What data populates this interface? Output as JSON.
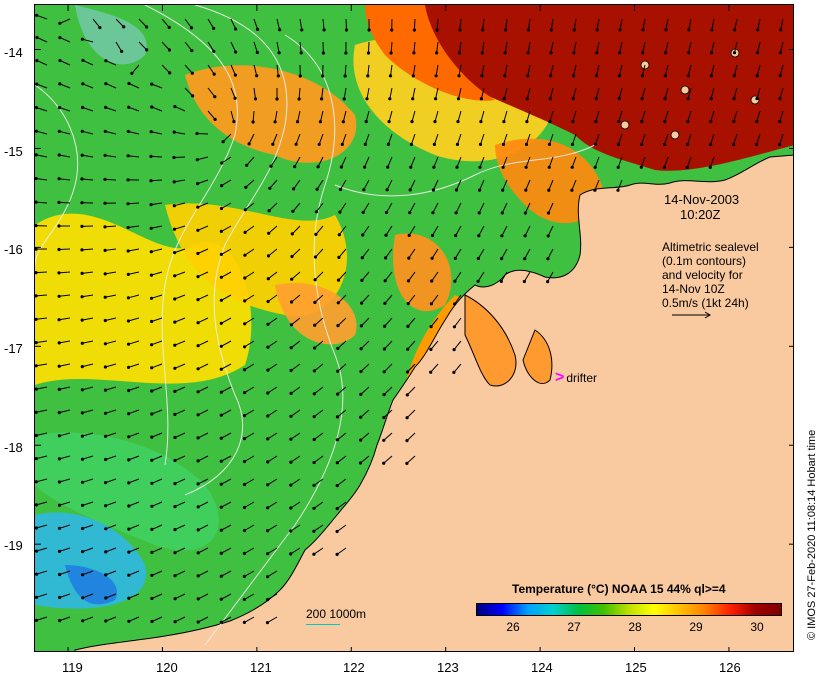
{
  "map": {
    "lon_ticks": [
      "119",
      "120",
      "121",
      "122",
      "123",
      "124",
      "125",
      "126"
    ],
    "lat_ticks": [
      "-14",
      "-15",
      "-16",
      "-17",
      "-18",
      "-19"
    ],
    "lon_range": [
      118.65,
      126.7
    ],
    "lat_range": [
      -13.55,
      -20.1
    ],
    "colors": {
      "land": "#f9c9a0",
      "coast": "#000000",
      "contour": "#f0f0f0",
      "drifter": "#ff00ff"
    }
  },
  "annotations": {
    "date": "14-Nov-2003",
    "time": "10:20Z",
    "legend_lines": [
      "Altimetric sealevel",
      "(0.1m contours)",
      "and velocity for",
      "14-Nov 10Z",
      "0.5m/s (1kt 24h)"
    ],
    "drifter_label": "drifter",
    "drifter_symbol": ">",
    "scale_text": "200  1000m",
    "credit": "© IMOS 27-Feb-2020 11:08:14 Hobart time"
  },
  "colorbar": {
    "title": "Temperature (°C) NOAA 15 44% ql>=4",
    "ticks": [
      "26",
      "27",
      "28",
      "29",
      "30"
    ],
    "range": [
      25.5,
      30.5
    ]
  }
}
